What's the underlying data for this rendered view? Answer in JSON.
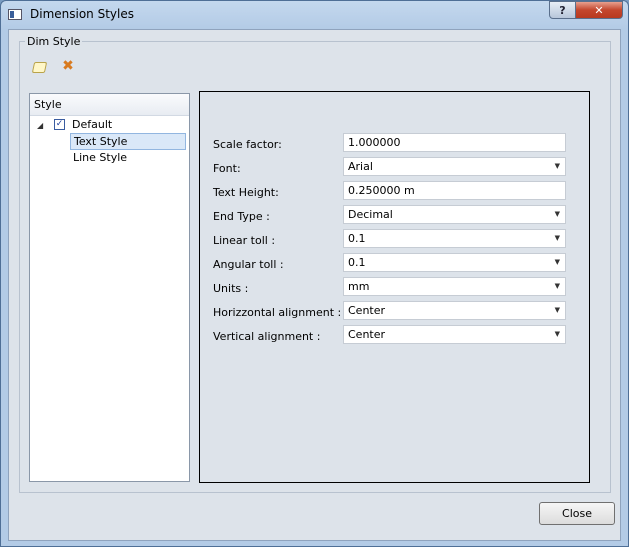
{
  "window": {
    "title": "Dimension Styles",
    "help_glyph": "?",
    "close_glyph": "✕"
  },
  "group": {
    "legend": "Dim Style"
  },
  "toolbar": {
    "new_icon": "new-style-icon",
    "delete_icon": "delete-style-icon"
  },
  "tree": {
    "header": "Style",
    "root": {
      "label": "Default",
      "checked": true,
      "expanded": true
    },
    "children": [
      {
        "label": "Text Style",
        "selected": true
      },
      {
        "label": "Line Style",
        "selected": false
      }
    ]
  },
  "properties": [
    {
      "label": "Scale factor:",
      "value": "1.000000",
      "type": "text"
    },
    {
      "label": "Font:",
      "value": "Arial",
      "type": "dropdown"
    },
    {
      "label": "Text Height:",
      "value": "0.250000 m",
      "type": "text"
    },
    {
      "label": "End Type :",
      "value": "Decimal",
      "type": "dropdown"
    },
    {
      "label": "Linear toll :",
      "value": "0.1",
      "type": "dropdown"
    },
    {
      "label": "Angular toll :",
      "value": "0.1",
      "type": "dropdown"
    },
    {
      "label": "Units :",
      "value": "mm",
      "type": "dropdown"
    },
    {
      "label": "Horizzontal alignment :",
      "value": "Center",
      "type": "dropdown"
    },
    {
      "label": "Vertical alignment :",
      "value": "Center",
      "type": "dropdown"
    }
  ],
  "footer": {
    "close_label": "Close"
  },
  "colors": {
    "client_bg": "#dde3ea",
    "selection_bg": "#dae8f8",
    "selection_border": "#92b6e0"
  }
}
